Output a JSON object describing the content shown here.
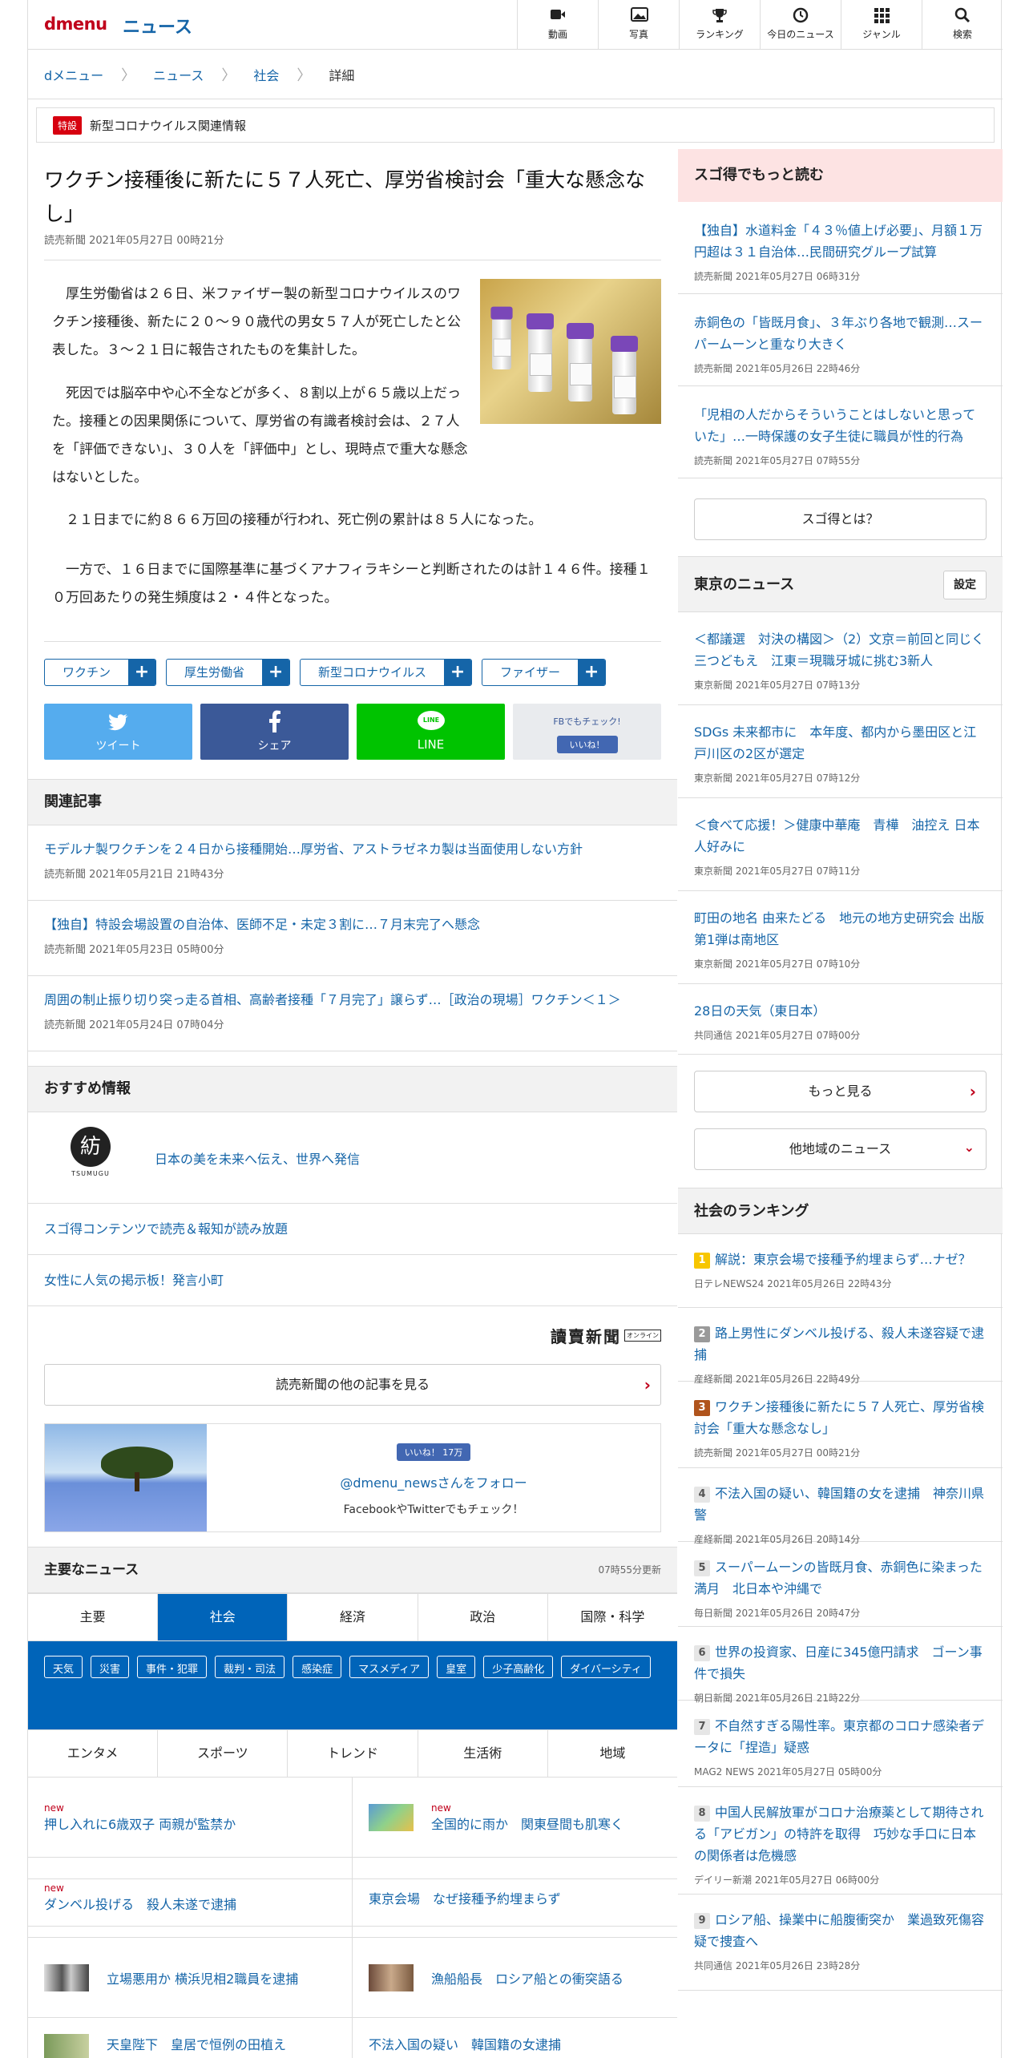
{
  "header": {
    "logo": "dmenu",
    "brand": "ニュース",
    "nav": [
      "動画",
      "写真",
      "ランキング",
      "今日のニュース",
      "ジャンル",
      "検索"
    ]
  },
  "breadcrumb": [
    "dメニュー",
    "ニュース",
    "社会",
    "詳細"
  ],
  "special": {
    "tag": "特設",
    "text": "新型コロナウイルス関連情報"
  },
  "article": {
    "title": "ワクチン接種後に新たに５７人死亡、厚労省検討会「重大な懸念なし」",
    "meta": "読売新聞 2021年05月27日 00時21分",
    "p1": "　厚生労働省は２６日、米ファイザー製の新型コロナウイルスのワクチン接種後、新たに２０～９０歳代の男女５７人が死亡したと公表した。３～２１日に報告されたものを集計した。",
    "p2": "　死因では脳卒中や心不全などが多く、８割以上が６５歳以上だった。接種との因果関係について、厚労省の有識者検討会は、２７人を「評価できない」、３０人を「評価中」とし、現時点で重大な懸念はないとした。",
    "p3": "　２１日までに約８６６万回の接種が行われ、死亡例の累計は８５人になった。",
    "p4": "　一方で、１６日までに国際基準に基づくアナフィラキシーと判断されたのは計１４６件。接種１０万回あたりの発生頻度は２・４件となった。",
    "tags": [
      "ワクチン",
      "厚生労働省",
      "新型コロナウイルス",
      "ファイザー"
    ],
    "share": {
      "twitter": "ツイート",
      "facebook": "シェア",
      "line": "LINE",
      "line_badge": "LINE",
      "fb_check": "FBでもチェック!",
      "fb_like": "いいね！"
    }
  },
  "related": {
    "heading": "関連記事",
    "items": [
      {
        "title": "モデルナ製ワクチンを２４日から接種開始…厚労省、アストラゼネカ製は当面使用しない方針",
        "meta": "読売新聞 2021年05月21日 21時43分"
      },
      {
        "title": "【独自】特設会場設置の自治体、医師不足・未定３割に…７月末完了へ懸念",
        "meta": "読売新聞 2021年05月23日 05時00分"
      },
      {
        "title": "周囲の制止振り切り突っ走る首相、高齢者接種「７月完了」譲らず…［政治の現場］ワクチン＜１＞",
        "meta": "読売新聞 2021年05月24日 07時04分"
      }
    ]
  },
  "recommend": {
    "heading": "おすすめ情報",
    "items": [
      "日本の美を未来へ伝え、世界へ発信",
      "スゴ得コンテンツで読売＆報知が読み放題",
      "女性に人気の掲示板！発言小町"
    ],
    "logo_text": "TSUMUGU"
  },
  "publisher": {
    "logo": "讀賣新聞",
    "badge": "オンライン",
    "more": "読売新聞の他の記事を見る"
  },
  "follow": {
    "like": "いいね！ 17万",
    "handle": "@dmenu_newsさんをフォロー",
    "sub": "FacebookやTwitterでもチェック！"
  },
  "mainnews": {
    "heading": "主要なニュース",
    "updated": "07時55分更新",
    "tabs1": [
      "主要",
      "社会",
      "経済",
      "政治",
      "国際・科学"
    ],
    "subcats": [
      "天気",
      "災害",
      "事件・犯罪",
      "裁判・司法",
      "感染症",
      "マスメディア",
      "皇室",
      "少子高齢化",
      "ダイバーシティ"
    ],
    "tabs2": [
      "エンタメ",
      "スポーツ",
      "トレンド",
      "生活術",
      "地域"
    ],
    "items": [
      {
        "new": "new",
        "title": "押し入れに6歳双子 両親が監禁か"
      },
      {
        "new": "new",
        "title": "全国的に雨か　関東昼間も肌寒く"
      },
      {
        "new": "new",
        "title": "ダンベル投げる　殺人未遂で逮捕"
      },
      {
        "new": "",
        "title": "東京会場　なぜ接種予約埋まらず"
      },
      {
        "new": "",
        "title": "立場悪用か 横浜児相2職員を逮捕"
      },
      {
        "new": "",
        "title": "漁船船長　ロシア船との衝突語る"
      },
      {
        "new": "",
        "title": "天皇陛下　皇居で恒例の田植え"
      },
      {
        "new": "",
        "title": "不法入国の疑い　韓国籍の女逮捕"
      }
    ]
  },
  "side": {
    "sugotoku": {
      "heading": "スゴ得でもっと読む",
      "items": [
        {
          "title": "【独自】水道料金「４３％値上げ必要」、月額１万円超は３１自治体…民間研究グループ試算",
          "meta": "読売新聞 2021年05月27日 06時31分"
        },
        {
          "title": "赤銅色の「皆既月食」、３年ぶり各地で観測…スーパームーンと重なり大きく",
          "meta": "読売新聞 2021年05月26日 22時46分"
        },
        {
          "title": "「児相の人だからそういうことはしないと思っていた」…一時保護の女子生徒に職員が性的行為",
          "meta": "読売新聞 2021年05月27日 07時55分"
        }
      ],
      "button": "スゴ得とは？"
    },
    "tokyo": {
      "heading": "東京のニュース",
      "settings": "設定",
      "items": [
        {
          "title": "＜都議選　対決の構図＞（2）文京＝前回と同じく三つどもえ　江東＝現職牙城に挑む3新人",
          "meta": "東京新聞 2021年05月27日 07時13分"
        },
        {
          "title": "SDGs 未来都市に　本年度、都内から墨田区と江戸川区の2区が選定",
          "meta": "東京新聞 2021年05月27日 07時12分"
        },
        {
          "title": "＜食べて応援！＞健康中華庵　青樺　油控え 日本人好みに",
          "meta": "東京新聞 2021年05月27日 07時11分"
        },
        {
          "title": "町田の地名 由来たどる　地元の地方史研究会 出版　第1弾は南地区",
          "meta": "東京新聞 2021年05月27日 07時10分"
        },
        {
          "title": "28日の天気（東日本）",
          "meta": "共同通信 2021年05月27日 07時00分"
        }
      ],
      "more": "もっと見る",
      "other": "他地域のニュース"
    },
    "ranking": {
      "heading": "社会のランキング",
      "items": [
        {
          "rank": "1",
          "title": "解説：東京会場で接種予約埋まらず…ナゼ？",
          "meta": "日テレNEWS24 2021年05月26日 22時43分"
        },
        {
          "rank": "2",
          "title": "路上男性にダンベル投げる、殺人未遂容疑で逮捕",
          "meta": "産経新聞 2021年05月26日 22時49分"
        },
        {
          "rank": "3",
          "title": "ワクチン接種後に新たに５７人死亡、厚労省検討会「重大な懸念なし」",
          "meta": "読売新聞 2021年05月27日 00時21分"
        },
        {
          "rank": "4",
          "title": "不法入国の疑い、韓国籍の女を逮捕　神奈川県警",
          "meta": "産経新聞 2021年05月26日 20時14分"
        },
        {
          "rank": "5",
          "title": "スーパームーンの皆既月食、赤銅色に染まった満月　北日本や沖縄で",
          "meta": "毎日新聞 2021年05月26日 20時47分"
        },
        {
          "rank": "6",
          "title": "世界の投資家、日産に345億円請求　ゴーン事件で損失",
          "meta": "朝日新聞 2021年05月26日 21時22分"
        },
        {
          "rank": "7",
          "title": "不自然すぎる陽性率。東京都のコロナ感染者データに「捏造」疑惑",
          "meta": "MAG2 NEWS 2021年05月27日 05時00分"
        },
        {
          "rank": "8",
          "title": "中国人民解放軍がコロナ治療薬として期待される「アビガン」の特許を取得　巧妙な手口に日本の関係者は危機感",
          "meta": "デイリー新潮 2021年05月27日 06時00分"
        },
        {
          "rank": "9",
          "title": "ロシア船、操業中に船腹衝突か　業過致死傷容疑で捜査へ",
          "meta": "共同通信 2021年05月26日 23時28分"
        }
      ]
    }
  }
}
